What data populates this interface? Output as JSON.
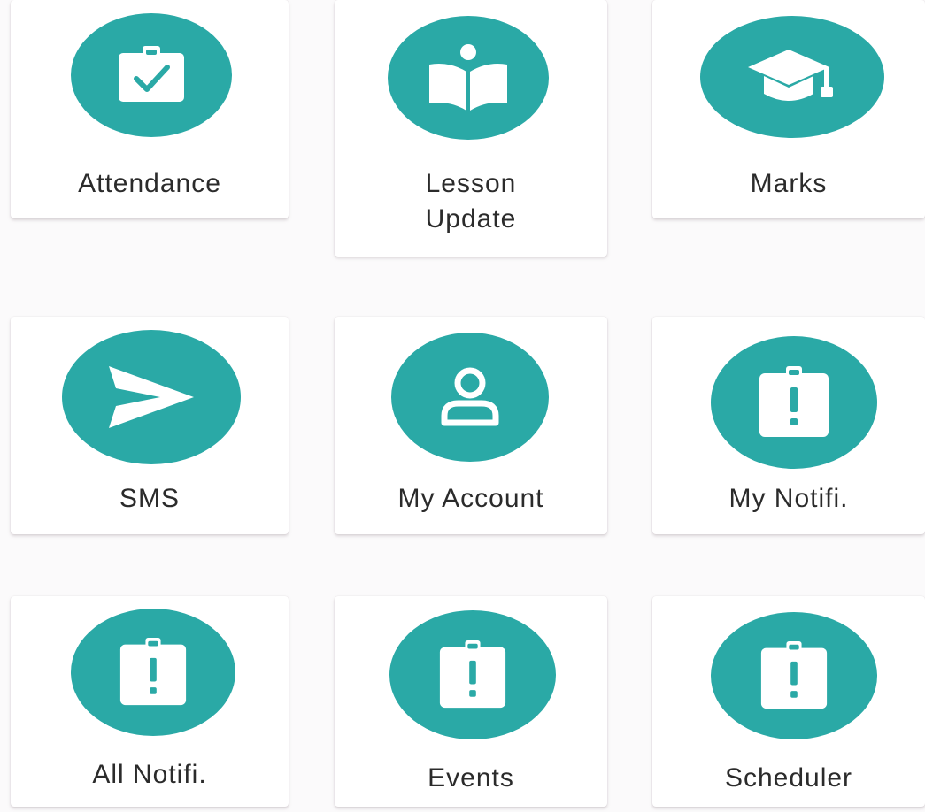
{
  "accent_color": "#2aa9a6",
  "tiles": [
    {
      "label": "Attendance",
      "icon": "clipboard-check-icon"
    },
    {
      "label_line1": "Lesson",
      "label_line2": "Update",
      "icon": "book-reader-icon"
    },
    {
      "label": "Marks",
      "icon": "graduation-cap-icon"
    },
    {
      "label": "SMS",
      "icon": "send-icon"
    },
    {
      "label": "My Account",
      "icon": "user-icon"
    },
    {
      "label": "My Notifi.",
      "icon": "clipboard-alert-icon"
    },
    {
      "label": "All Notifi.",
      "icon": "clipboard-alert-icon"
    },
    {
      "label": "Events",
      "icon": "clipboard-alert-icon"
    },
    {
      "label": "Scheduler",
      "icon": "clipboard-alert-icon"
    }
  ]
}
